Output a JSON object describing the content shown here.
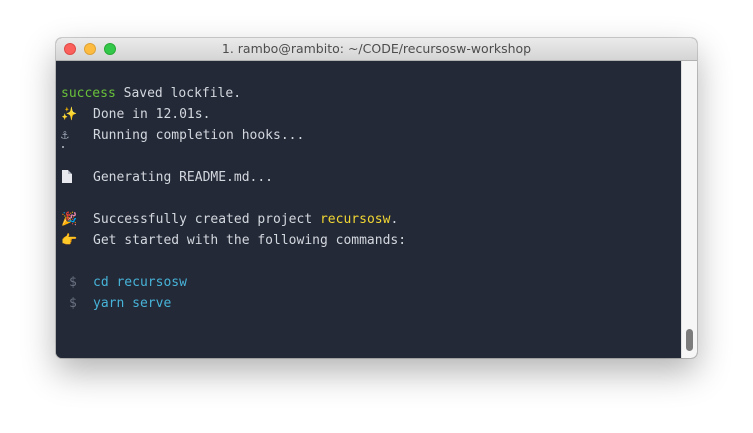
{
  "window": {
    "title": "1. rambo@rambito: ~/CODE/recursosw-workshop"
  },
  "terminal": {
    "line1": {
      "prefix": "success",
      "text": " Saved lockfile."
    },
    "line2": {
      "icon": "✨",
      "icon_name": "sparkles-icon",
      "text": "Done in 12.01s."
    },
    "line3": {
      "icon": "⚓",
      "icon_name": "anchor-icon",
      "text": "Running completion hooks..."
    },
    "line4": {
      "icon_name": "page-icon",
      "text": "Generating README.md..."
    },
    "line5": {
      "icon": "🎉",
      "icon_name": "party-popper-icon",
      "text": "Successfully created project ",
      "project": "recursosw",
      "suffix": "."
    },
    "line6": {
      "icon": "👉",
      "icon_name": "pointing-right-icon",
      "text": "Get started with the following commands:"
    },
    "commands": [
      {
        "prompt": "$",
        "command": "cd recursosw"
      },
      {
        "prompt": "$",
        "command": "yarn serve"
      }
    ]
  },
  "colors": {
    "background": "#232937",
    "success": "#69c13a",
    "project_name": "#f2d733",
    "command": "#47b3d8",
    "prompt": "#6a7180",
    "text": "#d3d7de"
  }
}
